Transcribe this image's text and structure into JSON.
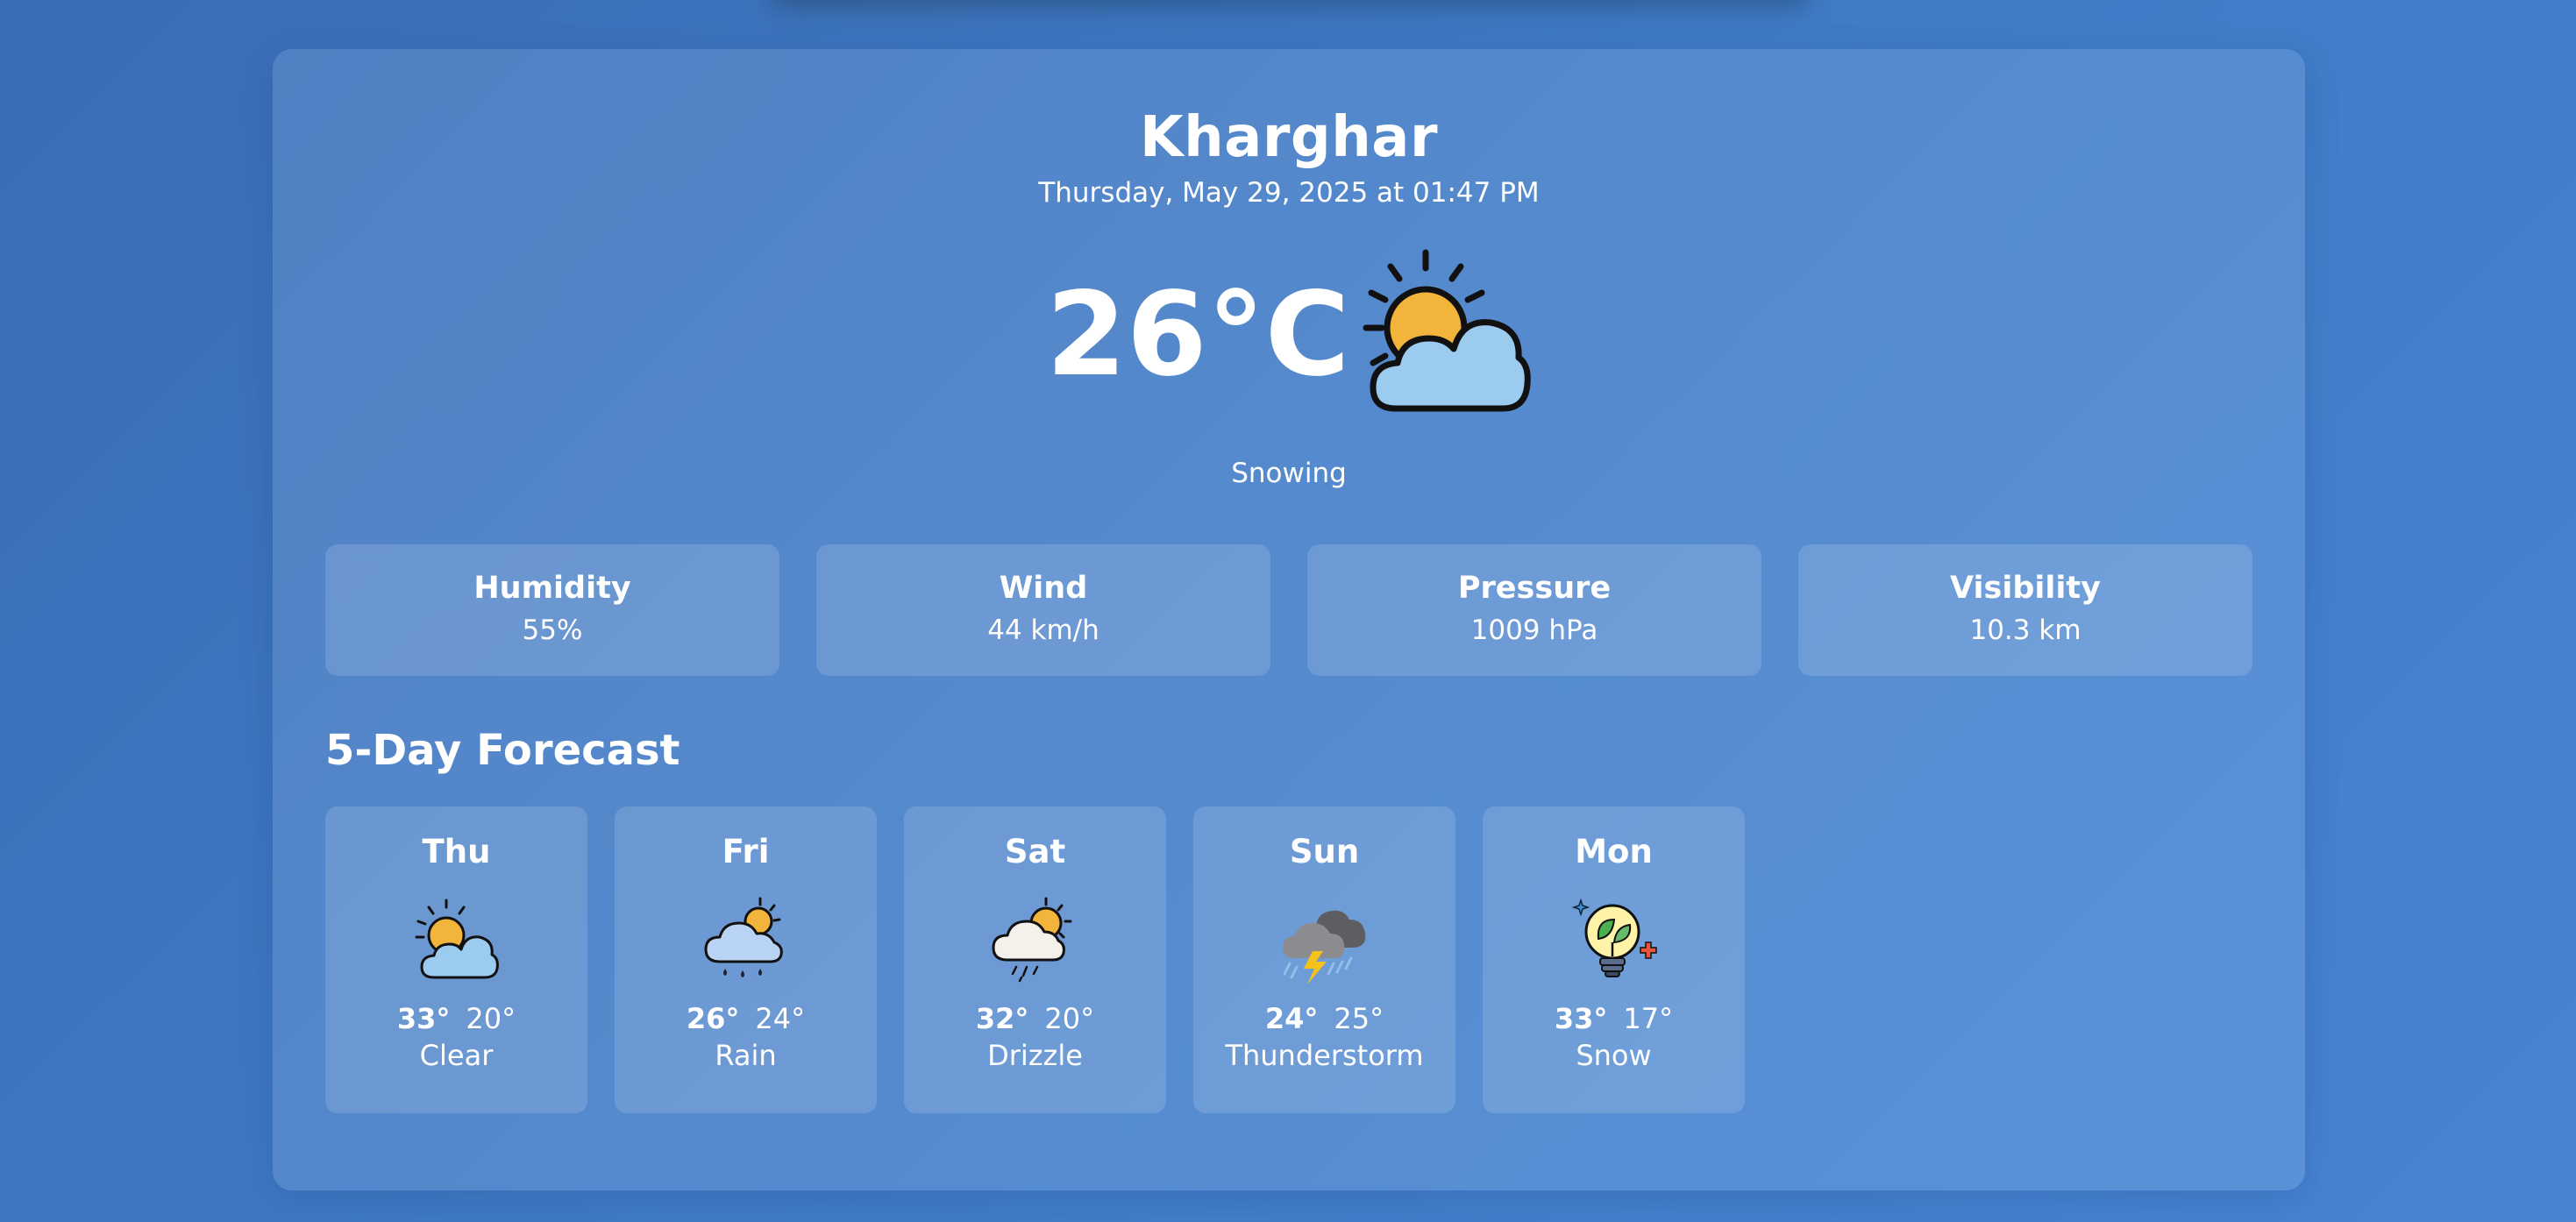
{
  "location": {
    "city": "Kharghar",
    "datetime": "Thursday, May 29, 2025 at 01:47 PM"
  },
  "current": {
    "temperature": "26°C",
    "condition": "Snowing",
    "icon": "partly-cloudy-icon"
  },
  "stats": [
    {
      "label": "Humidity",
      "value": "55%"
    },
    {
      "label": "Wind",
      "value": "44 km/h"
    },
    {
      "label": "Pressure",
      "value": "1009 hPa"
    },
    {
      "label": "Visibility",
      "value": "10.3 km"
    }
  ],
  "forecast": {
    "title": "5-Day Forecast",
    "days": [
      {
        "day": "Thu",
        "high": "33°",
        "low": "20°",
        "desc": "Clear",
        "icon": "partly-cloudy-icon"
      },
      {
        "day": "Fri",
        "high": "26°",
        "low": "24°",
        "desc": "Rain",
        "icon": "rain-cloud-icon"
      },
      {
        "day": "Sat",
        "high": "32°",
        "low": "20°",
        "desc": "Drizzle",
        "icon": "drizzle-icon"
      },
      {
        "day": "Sun",
        "high": "24°",
        "low": "25°",
        "desc": "Thunderstorm",
        "icon": "thunderstorm-icon"
      },
      {
        "day": "Mon",
        "high": "33°",
        "low": "17°",
        "desc": "Snow",
        "icon": "eco-lightbulb-icon"
      }
    ]
  },
  "colors": {
    "background": "#3f7ac4",
    "sun": "#f2b43a",
    "cloud": "#9ccbf0",
    "text": "#ffffff"
  }
}
